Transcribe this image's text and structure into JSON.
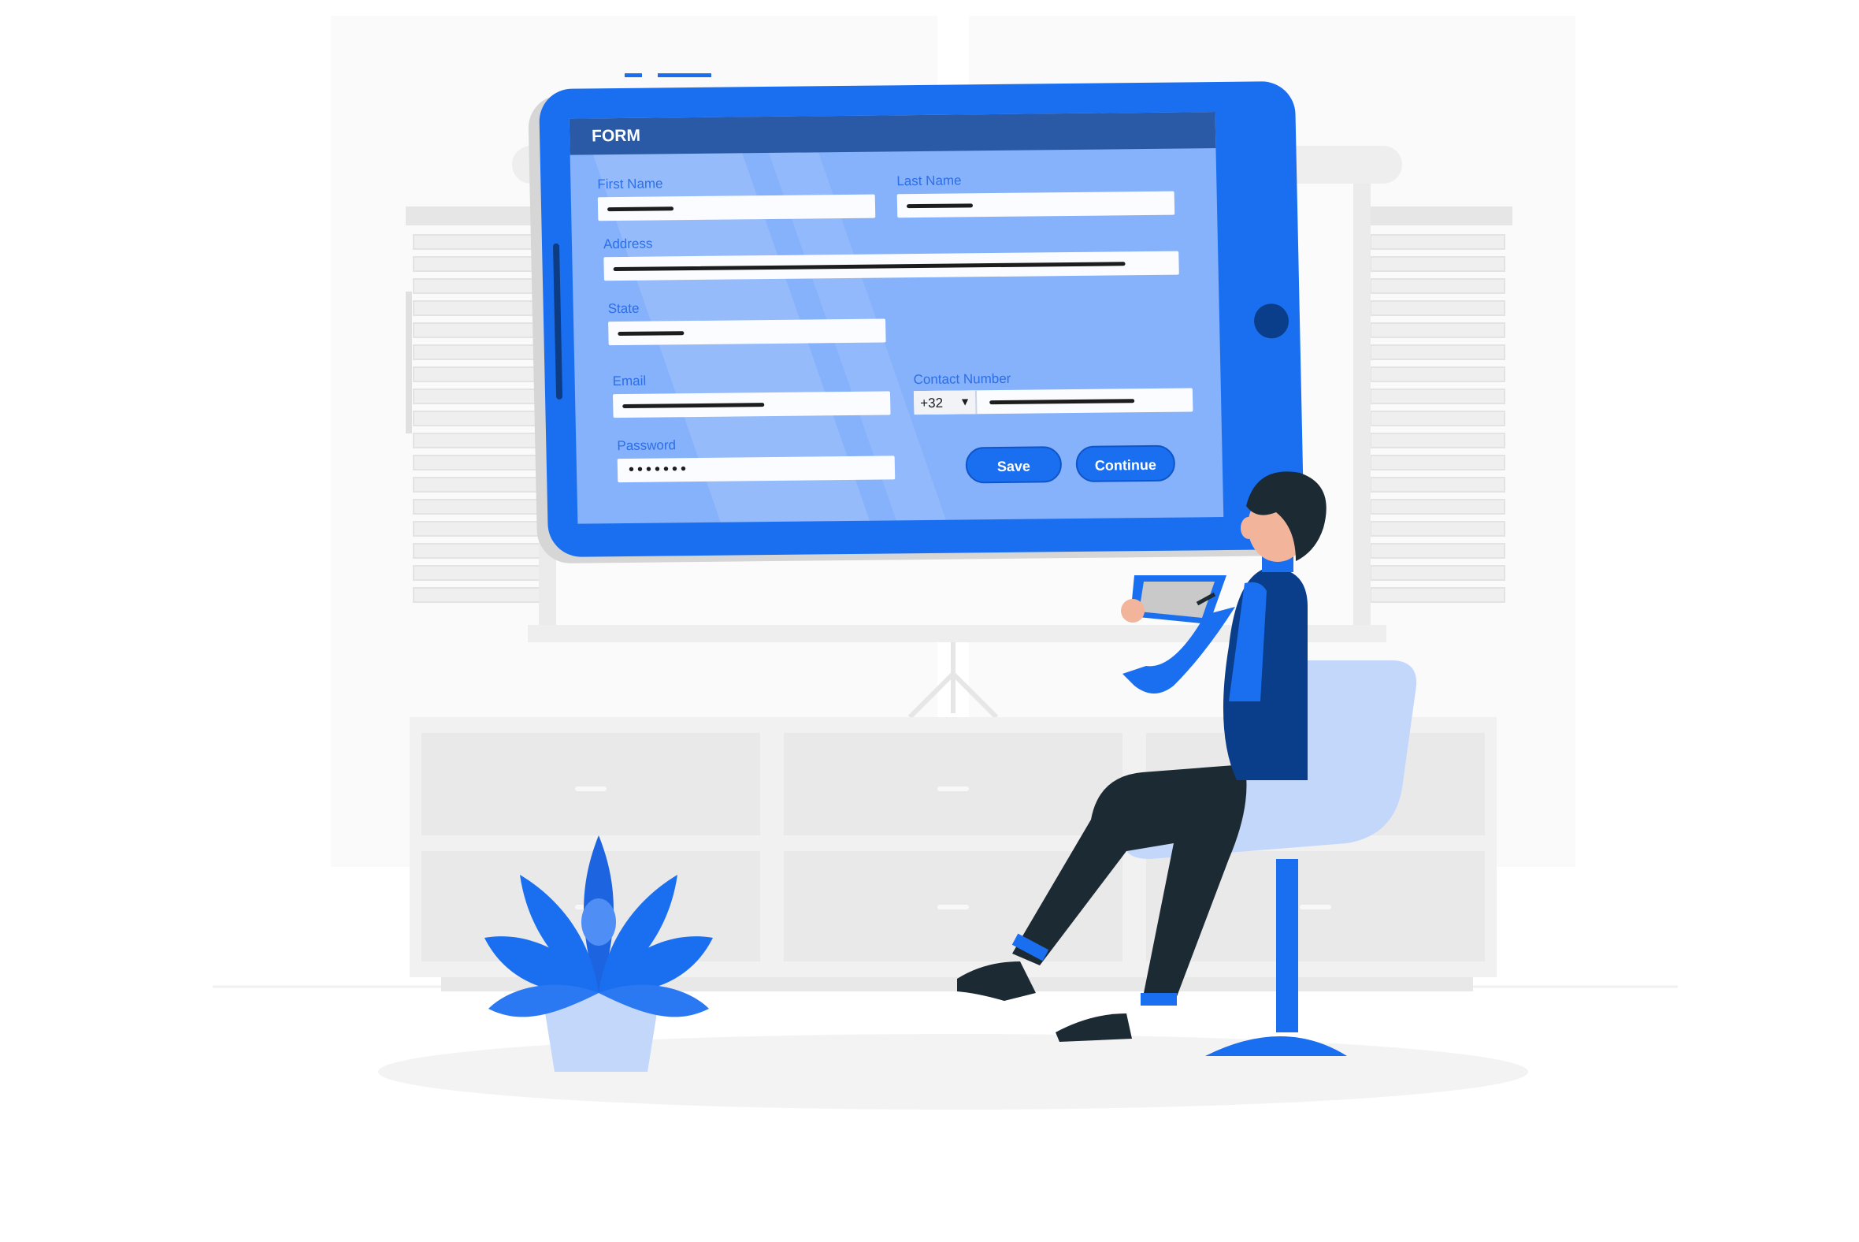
{
  "form": {
    "title": "FORM",
    "fields": {
      "first_name": {
        "label": "First Name",
        "value": ""
      },
      "last_name": {
        "label": "Last Name",
        "value": ""
      },
      "address": {
        "label": "Address",
        "value": ""
      },
      "state": {
        "label": "State",
        "value": ""
      },
      "email": {
        "label": "Email",
        "value": ""
      },
      "contact_number": {
        "label": "Contact Number",
        "country_code": "+32",
        "value": ""
      },
      "password": {
        "label": "Password",
        "masked": "•••••••"
      }
    },
    "buttons": {
      "save": "Save",
      "continue": "Continue"
    }
  },
  "colors": {
    "accent": "#1a6ff0",
    "screen": "#86b1fb",
    "header": "#2a5aa6",
    "dark": "#0a3e8a",
    "light_blue": "#c3d7fb"
  }
}
